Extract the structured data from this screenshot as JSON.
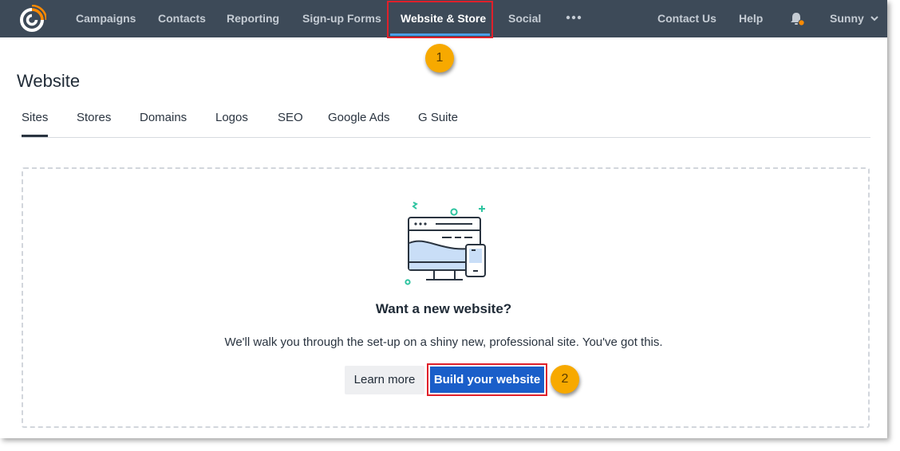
{
  "topnav": {
    "items": [
      {
        "label": "Campaigns"
      },
      {
        "label": "Contacts"
      },
      {
        "label": "Reporting"
      },
      {
        "label": "Sign-up Forms"
      },
      {
        "label": "Website & Store"
      },
      {
        "label": "Social"
      }
    ],
    "active_item": "Website & Store",
    "right": {
      "contact_label": "Contact Us",
      "help_label": "Help",
      "user_label": "Sunny"
    },
    "icons": [
      "logo-icon",
      "more-icon",
      "bell-icon",
      "chevron-down-icon"
    ]
  },
  "callouts": [
    "1",
    "2"
  ],
  "page": {
    "title": "Website",
    "tabs": [
      "Sites",
      "Stores",
      "Domains",
      "Logos",
      "SEO",
      "Google Ads",
      "G Suite"
    ],
    "active_tab": "Sites"
  },
  "empty_state": {
    "title": "Want a new website?",
    "description": "We'll walk you through the set-up on a shiny new, professional site. You've got this.",
    "learn_more_label": "Learn more",
    "build_label": "Build your website"
  },
  "colors": {
    "nav_bg": "#3d4a58",
    "primary_button": "#1a5ec9",
    "highlight": "#e0202a",
    "callout": "#f7a900",
    "accent": "#ff8a00"
  }
}
